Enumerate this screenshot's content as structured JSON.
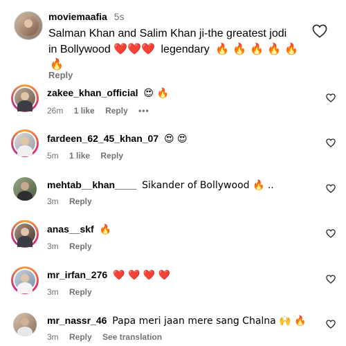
{
  "main_comment": {
    "username": "moviemaafia",
    "time": "5s",
    "line1": "Salman Khan and Salim Khan ji-the greatest jodi",
    "line2_prefix": "in Bollywood",
    "hearts": "❤️❤️❤️",
    "line2_word": "legendary",
    "fires": "🔥 🔥 🔥 🔥 🔥",
    "line3": "🔥",
    "reply": "Reply"
  },
  "replies": [
    {
      "username": "zakee_khan_official",
      "text": "😍 🔥",
      "time": "26m",
      "likes": "1 like",
      "reply": "Reply",
      "more": "•••"
    },
    {
      "username": "fardeen_62_45_khan_07",
      "text": "😍 😍",
      "time": "5m",
      "likes": "1 like",
      "reply": "Reply"
    },
    {
      "username": "mehtab__khan____",
      "text": "Sikander of Bollywood 🔥 ..",
      "time": "3m",
      "reply": "Reply"
    },
    {
      "username": "anas__skf",
      "text": "🔥",
      "time": "3m",
      "reply": "Reply"
    },
    {
      "username": "mr_irfan_276",
      "text": "❤️ ❤️ ❤️ ❤️",
      "time": "3m",
      "reply": "Reply"
    },
    {
      "username": "mr_nassr_46",
      "text": "Papa meri jaan mere sang Chalna 🙌 🔥",
      "time": "3m",
      "reply": "Reply",
      "translation": "See translation"
    }
  ],
  "icons": {
    "like": "heart-outline-icon",
    "more": "more-options-icon"
  },
  "colors": {
    "meta_text": "#737373",
    "heart_red": "#e0245e",
    "story_ring": "#e1306c"
  }
}
